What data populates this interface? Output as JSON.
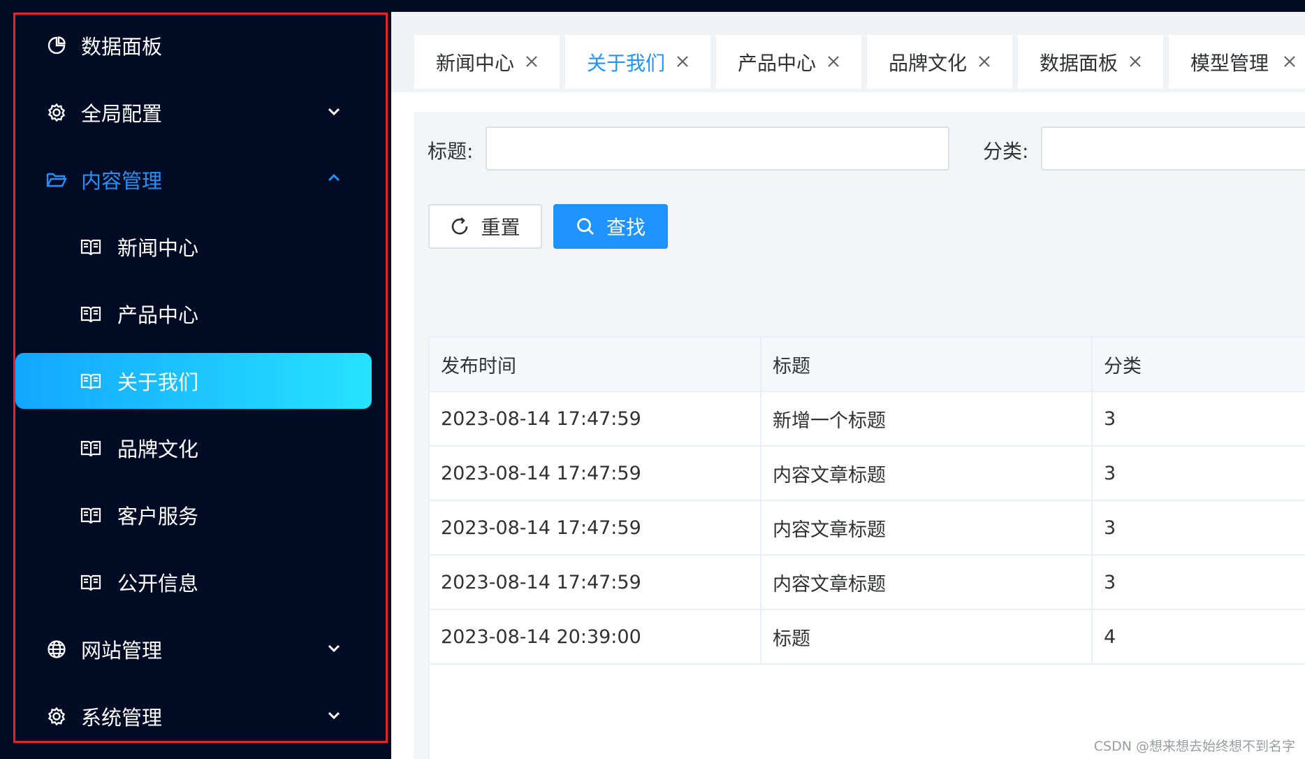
{
  "sidebar": {
    "items": [
      {
        "label": "数据面板",
        "icon": "pie-chart-icon"
      },
      {
        "label": "全局配置",
        "icon": "gear-icon",
        "expandable": true
      },
      {
        "label": "内容管理",
        "icon": "folder-open-icon",
        "expanded": true
      },
      {
        "label": "新闻中心",
        "icon": "book-icon",
        "sub": true
      },
      {
        "label": "产品中心",
        "icon": "book-icon",
        "sub": true
      },
      {
        "label": "关于我们",
        "icon": "book-icon",
        "sub": true,
        "active": true
      },
      {
        "label": "品牌文化",
        "icon": "book-icon",
        "sub": true
      },
      {
        "label": "客户服务",
        "icon": "book-icon",
        "sub": true
      },
      {
        "label": "公开信息",
        "icon": "book-icon",
        "sub": true
      },
      {
        "label": "网站管理",
        "icon": "globe-icon",
        "expandable": true
      },
      {
        "label": "系统管理",
        "icon": "gear-icon",
        "expandable": true
      }
    ]
  },
  "tabs": [
    {
      "label": "新闻中心"
    },
    {
      "label": "关于我们",
      "active": true
    },
    {
      "label": "产品中心"
    },
    {
      "label": "品牌文化"
    },
    {
      "label": "数据面板"
    },
    {
      "label": "模型管理"
    }
  ],
  "filters": {
    "title_label": "标题:",
    "title_value": "",
    "category_label": "分类:",
    "category_value": ""
  },
  "buttons": {
    "reset_label": "重置",
    "search_label": "查找"
  },
  "table": {
    "columns": [
      "发布时间",
      "标题",
      "分类"
    ],
    "rows": [
      [
        "2023-08-14 17:47:59",
        "新增一个标题",
        "3"
      ],
      [
        "2023-08-14 17:47:59",
        "内容文章标题",
        "3"
      ],
      [
        "2023-08-14 17:47:59",
        "内容文章标题",
        "3"
      ],
      [
        "2023-08-14 17:47:59",
        "内容文章标题",
        "3"
      ],
      [
        "2023-08-14 20:39:00",
        "标题",
        "4"
      ]
    ]
  },
  "watermark": "CSDN @想来想去始终想不到名字",
  "colors": {
    "sidebar_bg": "#020b24",
    "accent": "#1f93ff",
    "active_gradient_start": "#12a7ff",
    "active_gradient_end": "#27e2ff",
    "frame_border": "#e3242b"
  }
}
